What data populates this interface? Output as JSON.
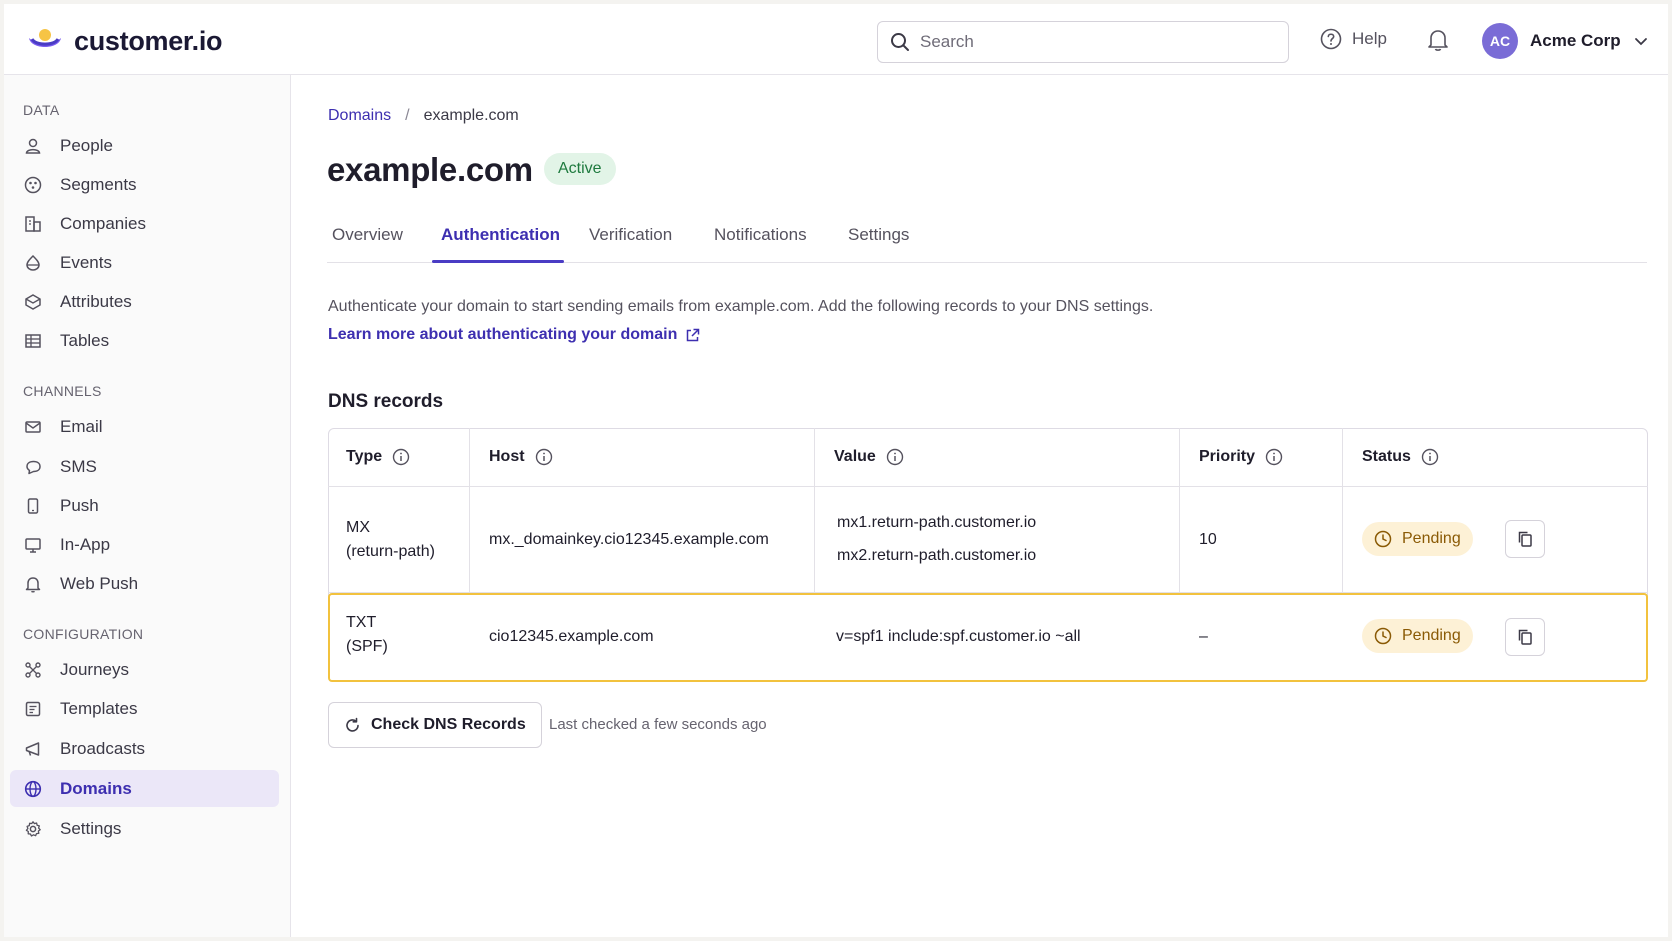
{
  "brand": {
    "name": "customer.io",
    "colors": {
      "accent": "#4a3cc4",
      "pending": "#fdf1d6",
      "active": "#e2f4e7",
      "highlight": "#f2c23e"
    }
  },
  "header": {
    "search_placeholder": "Search",
    "help_label": "Help",
    "account": {
      "initials": "AC",
      "name": "Acme Corp"
    }
  },
  "sidebar": {
    "sections": [
      {
        "title": "DATA",
        "items": [
          {
            "label": "People",
            "icon": "person-icon"
          },
          {
            "label": "Segments",
            "icon": "segments-icon"
          },
          {
            "label": "Companies",
            "icon": "building-icon"
          },
          {
            "label": "Events",
            "icon": "events-icon"
          },
          {
            "label": "Attributes",
            "icon": "attributes-icon"
          },
          {
            "label": "Tables",
            "icon": "table-icon"
          }
        ]
      },
      {
        "title": "CHANNELS",
        "items": [
          {
            "label": "Email",
            "icon": "mail-icon"
          },
          {
            "label": "SMS",
            "icon": "chat-icon"
          },
          {
            "label": "Push",
            "icon": "phone-icon"
          },
          {
            "label": "In-App",
            "icon": "monitor-icon"
          },
          {
            "label": "Web Push",
            "icon": "bell-icon"
          }
        ]
      },
      {
        "title": "CONFIGURATION",
        "items": [
          {
            "label": "Journeys",
            "icon": "journeys-icon"
          },
          {
            "label": "Templates",
            "icon": "templates-icon"
          },
          {
            "label": "Broadcasts",
            "icon": "megaphone-icon"
          },
          {
            "label": "Domains",
            "icon": "globe-icon",
            "active": true
          },
          {
            "label": "Settings",
            "icon": "gear-icon"
          }
        ]
      }
    ]
  },
  "breadcrumb": {
    "parent": "Domains",
    "separator": "/",
    "current": "example.com"
  },
  "page": {
    "title": "example.com",
    "status": "Active"
  },
  "tabs": [
    "Overview",
    "Authentication",
    "Verification",
    "Notifications",
    "Settings"
  ],
  "active_tab": "Authentication",
  "auth": {
    "description": "Authenticate your domain to start sending emails from example.com. Add the following records to your DNS settings.",
    "learn_more": "Learn more about authenticating your domain"
  },
  "dns": {
    "heading": "DNS records",
    "columns": [
      "Type",
      "Host",
      "Value",
      "Priority",
      "Status"
    ],
    "rows": [
      {
        "type_line1": "MX",
        "type_line2": "(return-path)",
        "host": "mx._domainkey.cio12345.example.com",
        "value_line1": "mx1.return-path.customer.io",
        "value_line2": "mx2.return-path.customer.io",
        "priority": "10",
        "status": "Pending"
      },
      {
        "type_line1": "TXT",
        "type_line2": "(SPF)",
        "host": "cio12345.example.com",
        "value_line1": "v=spf1 include:spf.customer.io ~all",
        "priority": "–",
        "status": "Pending",
        "highlighted": true
      }
    ],
    "check_button": "Check DNS Records",
    "last_checked": "Last checked a few seconds ago"
  }
}
